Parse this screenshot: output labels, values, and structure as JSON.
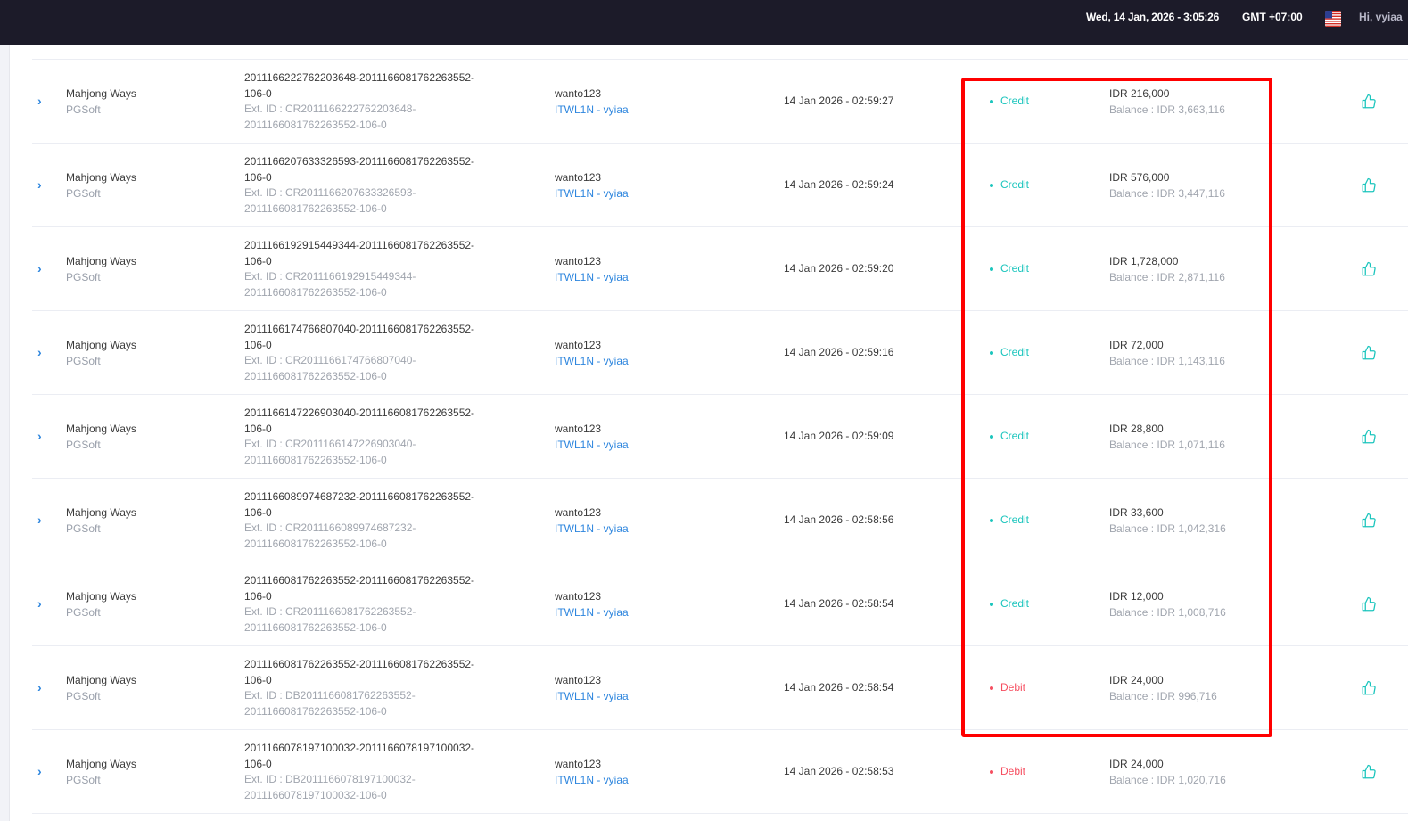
{
  "header": {
    "datetime": "Wed, 14 Jan, 2026 - 3:05:26",
    "timezone": "GMT +07:00",
    "greeting": "Hi, vyiaa",
    "flag_icon": "us-flag-icon"
  },
  "colors": {
    "credit": "#1bc5bd",
    "debit": "#f64e60",
    "link": "#2e86de",
    "highlight": "#ff0000"
  },
  "rows": [
    {
      "game": "Mahjong Ways",
      "provider": "PGSoft",
      "tx_id": "20111662227622036 48-20111660817622635 52-106-0",
      "tx_main_1": "2011166222762203648-2011166081762263552-",
      "tx_main_2": "106-0",
      "ext_1": "Ext. ID : CR2011166222762203648-",
      "ext_2": "2011166081762263552-106-0",
      "user": "wanto123",
      "agent": "ITWL1N - vyiaa",
      "time": "14 Jan 2026 - 02:59:27",
      "type": "Credit",
      "amount": "IDR 216,000",
      "balance": "Balance : IDR 3,663,116"
    },
    {
      "game": "Mahjong Ways",
      "provider": "PGSoft",
      "tx_main_1": "2011166207633326593-2011166081762263552-",
      "tx_main_2": "106-0",
      "ext_1": "Ext. ID : CR2011166207633326593-",
      "ext_2": "2011166081762263552-106-0",
      "user": "wanto123",
      "agent": "ITWL1N - vyiaa",
      "time": "14 Jan 2026 - 02:59:24",
      "type": "Credit",
      "amount": "IDR 576,000",
      "balance": "Balance : IDR 3,447,116"
    },
    {
      "game": "Mahjong Ways",
      "provider": "PGSoft",
      "tx_main_1": "2011166192915449344-2011166081762263552-",
      "tx_main_2": "106-0",
      "ext_1": "Ext. ID : CR2011166192915449344-",
      "ext_2": "2011166081762263552-106-0",
      "user": "wanto123",
      "agent": "ITWL1N - vyiaa",
      "time": "14 Jan 2026 - 02:59:20",
      "type": "Credit",
      "amount": "IDR 1,728,000",
      "balance": "Balance : IDR 2,871,116"
    },
    {
      "game": "Mahjong Ways",
      "provider": "PGSoft",
      "tx_main_1": "2011166174766807040-2011166081762263552-",
      "tx_main_2": "106-0",
      "ext_1": "Ext. ID : CR2011166174766807040-",
      "ext_2": "2011166081762263552-106-0",
      "user": "wanto123",
      "agent": "ITWL1N - vyiaa",
      "time": "14 Jan 2026 - 02:59:16",
      "type": "Credit",
      "amount": "IDR 72,000",
      "balance": "Balance : IDR 1,143,116"
    },
    {
      "game": "Mahjong Ways",
      "provider": "PGSoft",
      "tx_main_1": "2011166147226903040-2011166081762263552-",
      "tx_main_2": "106-0",
      "ext_1": "Ext. ID : CR2011166147226903040-",
      "ext_2": "2011166081762263552-106-0",
      "user": "wanto123",
      "agent": "ITWL1N - vyiaa",
      "time": "14 Jan 2026 - 02:59:09",
      "type": "Credit",
      "amount": "IDR 28,800",
      "balance": "Balance : IDR 1,071,116"
    },
    {
      "game": "Mahjong Ways",
      "provider": "PGSoft",
      "tx_main_1": "2011166089974687232-2011166081762263552-",
      "tx_main_2": "106-0",
      "ext_1": "Ext. ID : CR2011166089974687232-",
      "ext_2": "2011166081762263552-106-0",
      "user": "wanto123",
      "agent": "ITWL1N - vyiaa",
      "time": "14 Jan 2026 - 02:58:56",
      "type": "Credit",
      "amount": "IDR 33,600",
      "balance": "Balance : IDR 1,042,316"
    },
    {
      "game": "Mahjong Ways",
      "provider": "PGSoft",
      "tx_main_1": "2011166081762263552-2011166081762263552-",
      "tx_main_2": "106-0",
      "ext_1": "Ext. ID : CR2011166081762263552-",
      "ext_2": "2011166081762263552-106-0",
      "user": "wanto123",
      "agent": "ITWL1N - vyiaa",
      "time": "14 Jan 2026 - 02:58:54",
      "type": "Credit",
      "amount": "IDR 12,000",
      "balance": "Balance : IDR 1,008,716"
    },
    {
      "game": "Mahjong Ways",
      "provider": "PGSoft",
      "tx_main_1": "2011166081762263552-2011166081762263552-",
      "tx_main_2": "106-0",
      "ext_1": "Ext. ID : DB2011166081762263552-",
      "ext_2": "2011166081762263552-106-0",
      "user": "wanto123",
      "agent": "ITWL1N - vyiaa",
      "time": "14 Jan 2026 - 02:58:54",
      "type": "Debit",
      "amount": "IDR 24,000",
      "balance": "Balance : IDR 996,716"
    },
    {
      "game": "Mahjong Ways",
      "provider": "PGSoft",
      "tx_main_1": "2011166078197100032-2011166078197100032-",
      "tx_main_2": "106-0",
      "ext_1": "Ext. ID : DB2011166078197100032-",
      "ext_2": "2011166078197100032-106-0",
      "user": "wanto123",
      "agent": "ITWL1N - vyiaa",
      "time": "14 Jan 2026 - 02:58:53",
      "type": "Debit",
      "amount": "IDR 24,000",
      "balance": "Balance : IDR 1,020,716"
    }
  ]
}
